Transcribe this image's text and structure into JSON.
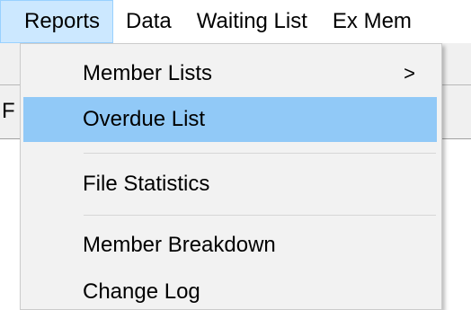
{
  "menubar": {
    "items": [
      {
        "label": "Reports"
      },
      {
        "label": "Data"
      },
      {
        "label": "Waiting List"
      },
      {
        "label": "Ex Mem"
      }
    ]
  },
  "background": {
    "partial_label": "F"
  },
  "dropdown": {
    "items": [
      {
        "label": "Member Lists",
        "submenu_arrow": ">"
      },
      {
        "label": "Overdue List"
      },
      {
        "label": "File Statistics"
      },
      {
        "label": "Member Breakdown"
      },
      {
        "label": "Change Log"
      }
    ],
    "highlight_color": "#91c9f7"
  }
}
